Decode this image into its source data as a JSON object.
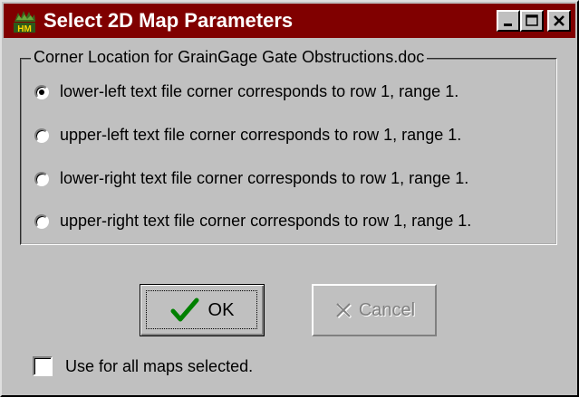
{
  "window": {
    "title": "Select 2D Map Parameters",
    "title_bar_color": "#800000",
    "buttons": {
      "minimize": "minimize",
      "maximize": "maximize",
      "close": "close"
    }
  },
  "group": {
    "legend": "Corner Location for GrainGage Gate Obstructions.doc",
    "options": [
      {
        "label": "lower-left text file corner corresponds to row 1, range 1.",
        "selected": true
      },
      {
        "label": "upper-left text file corner corresponds to row 1, range 1.",
        "selected": false
      },
      {
        "label": "lower-right text file corner corresponds to row 1, range 1.",
        "selected": false
      },
      {
        "label": "upper-right text file corner corresponds to row 1, range 1.",
        "selected": false
      }
    ]
  },
  "buttons": {
    "ok_label": "OK",
    "cancel_label": "Cancel",
    "cancel_enabled": false
  },
  "checkbox": {
    "label": "Use for all maps selected.",
    "checked": false
  },
  "icons": {
    "app": "hm-app-icon",
    "ok": "checkmark-icon",
    "cancel": "x-icon"
  }
}
